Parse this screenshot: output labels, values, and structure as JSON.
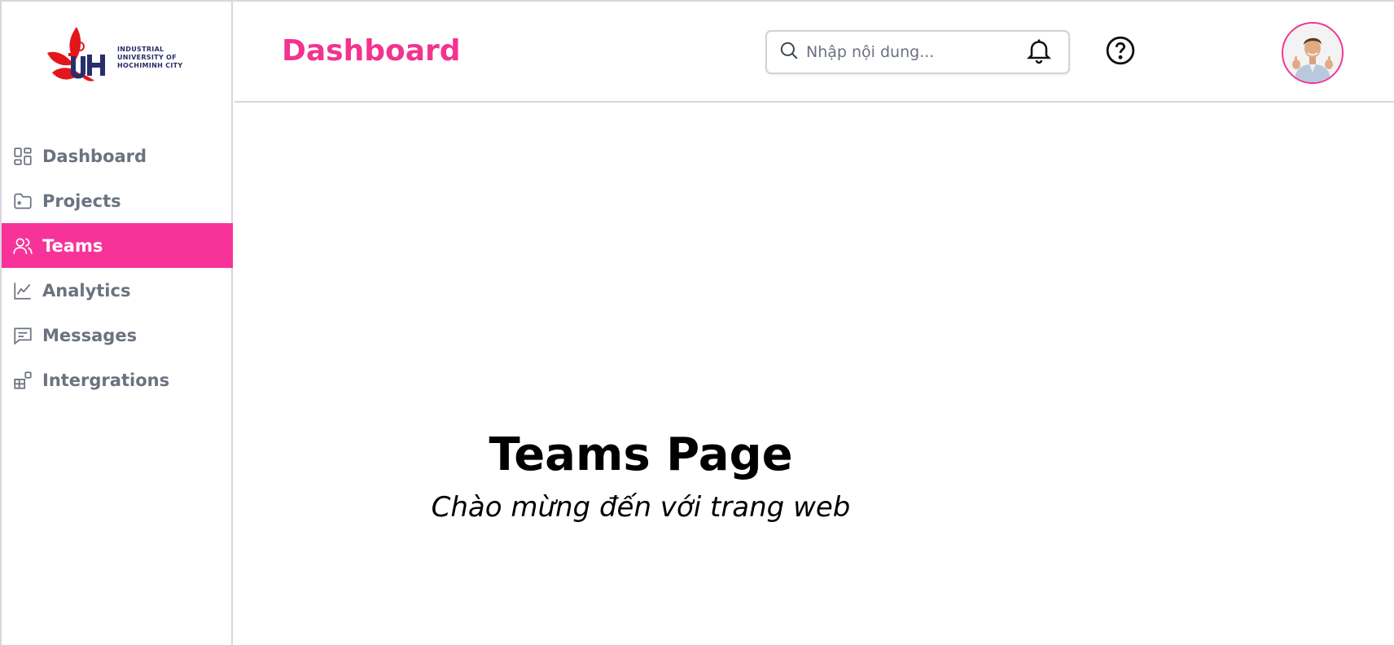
{
  "brand": {
    "logo_mark": "IUH",
    "logo_lines": [
      "INDUSTRIAL",
      "UNIVERSITY OF",
      "HOCHIMINH CITY"
    ]
  },
  "sidebar": {
    "items": [
      {
        "label": "Dashboard",
        "icon": "grid-icon",
        "active": false
      },
      {
        "label": "Projects",
        "icon": "folder-icon",
        "active": false
      },
      {
        "label": "Teams",
        "icon": "users-icon",
        "active": true
      },
      {
        "label": "Analytics",
        "icon": "chart-line-icon",
        "active": false
      },
      {
        "label": "Messages",
        "icon": "message-icon",
        "active": false
      },
      {
        "label": "Intergrations",
        "icon": "integrations-icon",
        "active": false
      }
    ]
  },
  "header": {
    "title": "Dashboard",
    "search_placeholder": "Nhập nội dung...",
    "notification_icon": "bell-icon",
    "help_icon": "help-circle-icon"
  },
  "main": {
    "heading": "Teams Page",
    "subtitle": "Chào mừng đến với trang web"
  },
  "colors": {
    "accent": "#f2348f",
    "active_bg": "#f73399",
    "muted": "#6b7280",
    "border": "#d6d8de"
  }
}
